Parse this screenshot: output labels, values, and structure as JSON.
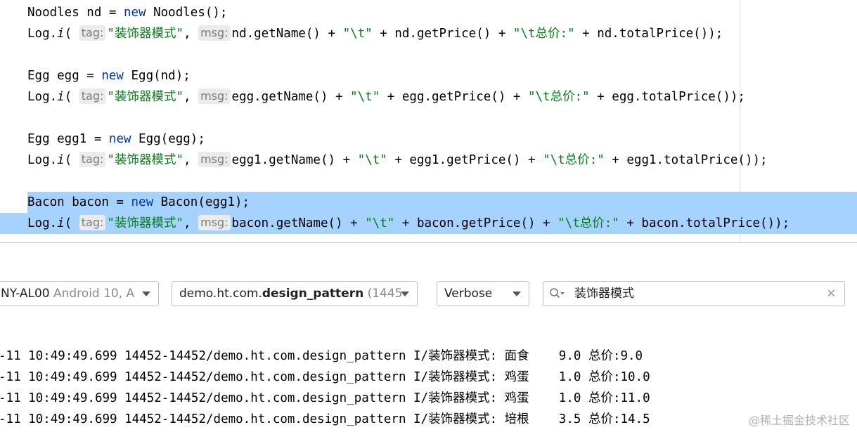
{
  "editor": {
    "lines": [
      {
        "parts": [
          [
            "t",
            "Noodles nd = "
          ],
          [
            "k",
            "new"
          ],
          [
            "t",
            " Noodles();"
          ]
        ]
      },
      {
        "parts": [
          [
            "t",
            "Log."
          ],
          [
            "m",
            "i"
          ],
          [
            "t",
            "( "
          ],
          [
            "h",
            "tag:"
          ],
          [
            "s",
            "\"装饰器模式\""
          ],
          [
            "t",
            ", "
          ],
          [
            "h",
            "msg:"
          ],
          [
            "t",
            "nd.getName() + "
          ],
          [
            "s",
            "\"\\t\""
          ],
          [
            "t",
            " + nd.getPrice() + "
          ],
          [
            "s",
            "\"\\t总价:\""
          ],
          [
            "t",
            " + nd.totalPrice());"
          ]
        ]
      },
      {
        "parts": []
      },
      {
        "parts": [
          [
            "t",
            "Egg egg = "
          ],
          [
            "k",
            "new"
          ],
          [
            "t",
            " Egg(nd);"
          ]
        ]
      },
      {
        "parts": [
          [
            "t",
            "Log."
          ],
          [
            "m",
            "i"
          ],
          [
            "t",
            "( "
          ],
          [
            "h",
            "tag:"
          ],
          [
            "s",
            "\"装饰器模式\""
          ],
          [
            "t",
            ", "
          ],
          [
            "h",
            "msg:"
          ],
          [
            "t",
            "egg.getName() + "
          ],
          [
            "s",
            "\"\\t\""
          ],
          [
            "t",
            " + egg.getPrice() + "
          ],
          [
            "s",
            "\"\\t总价:\""
          ],
          [
            "t",
            " + egg.totalPrice());"
          ]
        ]
      },
      {
        "parts": []
      },
      {
        "parts": [
          [
            "t",
            "Egg egg1 = "
          ],
          [
            "k",
            "new"
          ],
          [
            "t",
            " Egg(egg);"
          ]
        ]
      },
      {
        "parts": [
          [
            "t",
            "Log."
          ],
          [
            "m",
            "i"
          ],
          [
            "t",
            "( "
          ],
          [
            "h",
            "tag:"
          ],
          [
            "s",
            "\"装饰器模式\""
          ],
          [
            "t",
            ", "
          ],
          [
            "h",
            "msg:"
          ],
          [
            "t",
            "egg1.getName() + "
          ],
          [
            "s",
            "\"\\t\""
          ],
          [
            "t",
            " + egg1.getPrice() + "
          ],
          [
            "s",
            "\"\\t总价:\""
          ],
          [
            "t",
            " + egg1.totalPrice());"
          ]
        ]
      },
      {
        "parts": []
      },
      {
        "parts": [
          [
            "t",
            "Bacon bacon = "
          ],
          [
            "k",
            "new"
          ],
          [
            "t",
            " Bacon(egg1);"
          ]
        ],
        "selected": true
      },
      {
        "parts": [
          [
            "t",
            "Log."
          ],
          [
            "m",
            "i"
          ],
          [
            "t",
            "( "
          ],
          [
            "h",
            "tag:"
          ],
          [
            "s",
            "\"装饰器模式\""
          ],
          [
            "t",
            ", "
          ],
          [
            "h",
            "msg:"
          ],
          [
            "t",
            "bacon.getName() + "
          ],
          [
            "s",
            "\"\\t\""
          ],
          [
            "t",
            " + bacon.getPrice() + "
          ],
          [
            "s",
            "\"\\t总价:\""
          ],
          [
            "t",
            " + bacon.totalPrice());"
          ]
        ],
        "selected": true
      }
    ]
  },
  "logcat_toolbar": {
    "device": {
      "name": "NY-AL00",
      "detail": " Android 10, A"
    },
    "process": {
      "prefix": "demo.ht.com.",
      "bold": "design_pattern",
      "pid": " (1445"
    },
    "level": "Verbose",
    "search": {
      "value": "装饰器模式",
      "clear": "✕"
    }
  },
  "logcat": {
    "lines": [
      "-11 10:49:49.699 14452-14452/demo.ht.com.design_pattern I/装饰器模式: 面食    9.0 总价:9.0",
      "-11 10:49:49.699 14452-14452/demo.ht.com.design_pattern I/装饰器模式: 鸡蛋    1.0 总价:10.0",
      "-11 10:49:49.699 14452-14452/demo.ht.com.design_pattern I/装饰器模式: 鸡蛋    1.0 总价:11.0",
      "-11 10:49:49.699 14452-14452/demo.ht.com.design_pattern I/装饰器模式: 培根    3.5 总价:14.5"
    ]
  },
  "watermark": "@稀土掘金技术社区",
  "colors": {
    "keyword": "#0033b3",
    "string": "#067d17",
    "selection": "#a6d2ff",
    "hint_bg": "#ebebeb"
  }
}
